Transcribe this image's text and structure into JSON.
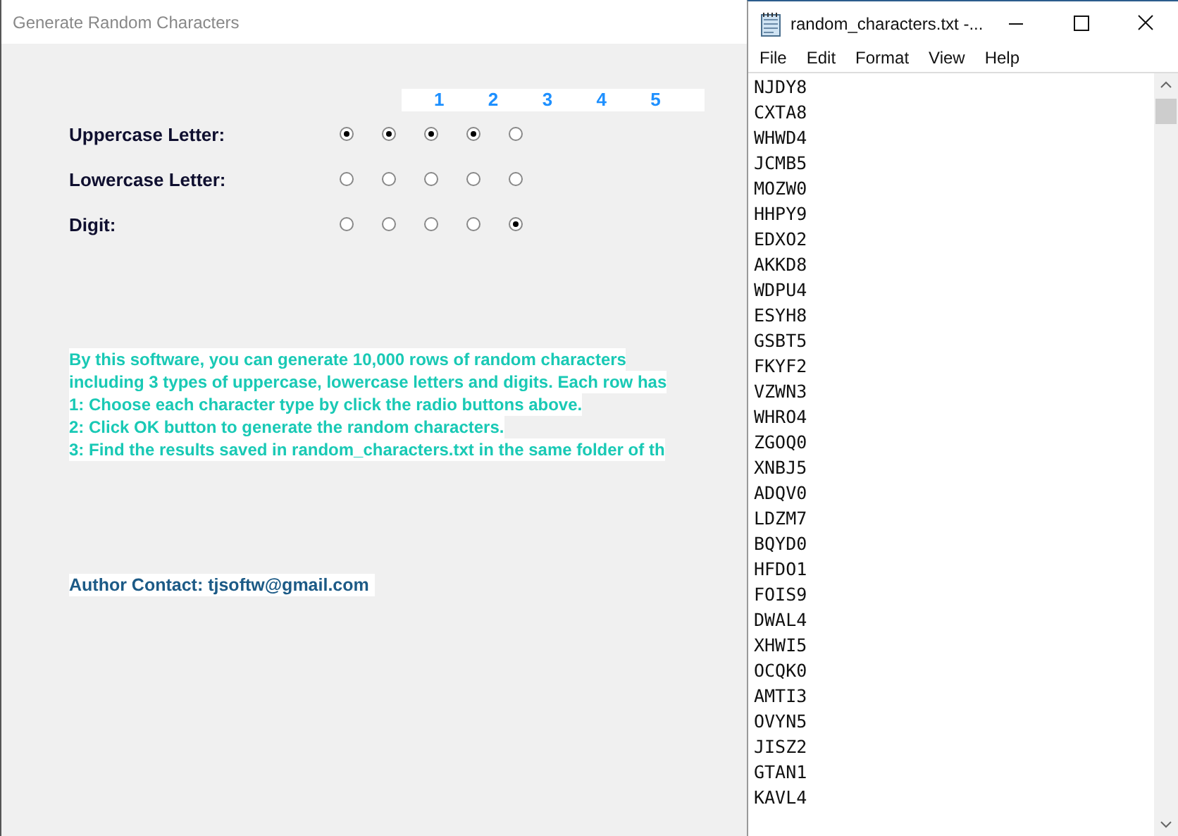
{
  "main_window": {
    "title": "Generate Random Characters",
    "column_headers": [
      "1",
      "2",
      "3",
      "4",
      "5"
    ],
    "rows": [
      {
        "label": "Uppercase Letter:",
        "options": [
          {
            "selected": true
          },
          {
            "selected": true
          },
          {
            "selected": true
          },
          {
            "selected": true
          },
          {
            "selected": false
          }
        ]
      },
      {
        "label": "Lowercase Letter:",
        "options": [
          {
            "selected": false
          },
          {
            "selected": false
          },
          {
            "selected": false
          },
          {
            "selected": false
          },
          {
            "selected": false
          }
        ]
      },
      {
        "label": "Digit:",
        "options": [
          {
            "selected": false
          },
          {
            "selected": false
          },
          {
            "selected": false
          },
          {
            "selected": false
          },
          {
            "selected": true
          }
        ]
      }
    ],
    "description": [
      "By this software, you can generate 10,000 rows of random characters",
      "including 3 types of uppercase, lowercase letters and digits. Each row has",
      "1: Choose each character type by click the radio buttons above.",
      "2: Click OK button to generate the random characters.",
      "3: Find the results saved in random_characters.txt in the same folder of th"
    ],
    "author": "Author Contact: tjsoftw@gmail.com"
  },
  "notepad": {
    "title": "random_characters.txt -...",
    "menu": [
      "File",
      "Edit",
      "Format",
      "View",
      "Help"
    ],
    "lines": [
      "NJDY8",
      "CXTA8",
      "WHWD4",
      "JCMB5",
      "MOZW0",
      "HHPY9",
      "EDXO2",
      "AKKD8",
      "WDPU4",
      "ESYH8",
      "GSBT5",
      "FKYF2",
      "VZWN3",
      "WHRO4",
      "ZGOQ0",
      "XNBJ5",
      "ADQV0",
      "LDZM7",
      "BQYD0",
      "HFDO1",
      "FOIS9",
      "DWAL4",
      "XHWI5",
      "OCQK0",
      "AMTI3",
      "OVYN5",
      "JISZ2",
      "GTAN1",
      "KAVL4"
    ]
  }
}
